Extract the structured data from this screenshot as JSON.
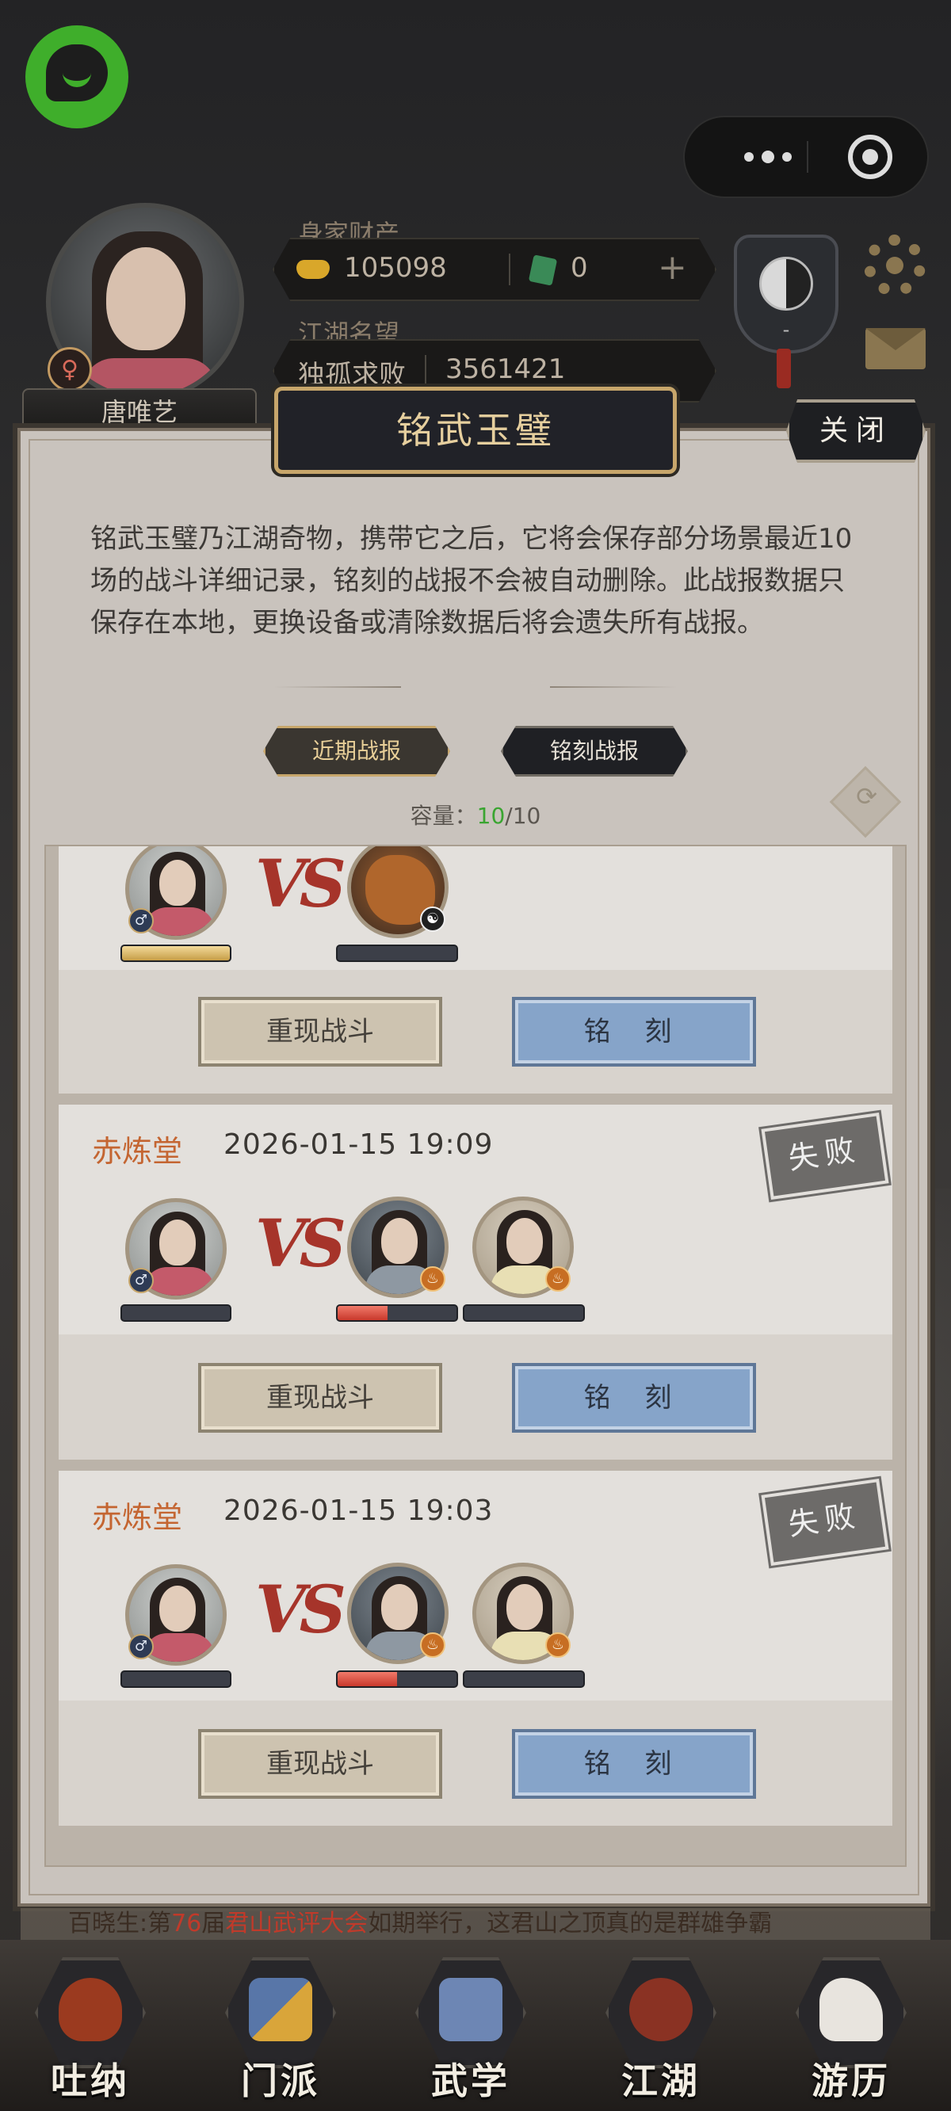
{
  "header": {
    "player_name": "唐唯艺",
    "gender_symbol": "♀",
    "wealth_label": "身家财产",
    "gold": "105098",
    "jade": "0",
    "plus": "+",
    "fame_label": "江湖名望",
    "fame_title": "独孤求败",
    "fame_value": "3561421",
    "shield_rank": "-",
    "capsule_icons": [
      "more-icon",
      "target-icon"
    ],
    "side_icons": [
      "gear-icon",
      "mail-icon"
    ]
  },
  "modal": {
    "title": "铭武玉璧",
    "close_label": "关闭",
    "description": "铭武玉璧乃江湖奇物，携带它之后，它将会保存部分场景最近10场的战斗详细记录，铭刻的战报不会被自动删除。此战报数据只保存在本地，更换设备或清除数据后将会遗失所有战报。",
    "tabs": [
      "近期战报",
      "铭刻战报"
    ],
    "capacity_label": "容量：",
    "capacity_used": "10",
    "capacity_total": "/10"
  },
  "battles": [
    {
      "faction": "",
      "time": "",
      "result": "",
      "player_hp": 1.0,
      "enemy_hp": [
        0.0
      ],
      "replay_label": "重现战斗",
      "engrave_label": "铭 刻"
    },
    {
      "faction": "赤炼堂",
      "time": "2026-01-15 19:09",
      "result": "失败",
      "player_hp": 0.0,
      "enemy_hp": [
        0.42,
        0.0
      ],
      "replay_label": "重现战斗",
      "engrave_label": "铭 刻"
    },
    {
      "faction": "赤炼堂",
      "time": "2026-01-15 19:03",
      "result": "失败",
      "player_hp": 0.0,
      "enemy_hp": [
        0.5,
        0.0
      ],
      "replay_label": "重现战斗",
      "engrave_label": "铭 刻"
    }
  ],
  "vs_label": "VS",
  "ticker": {
    "prefix": "百晓生:第",
    "number": "76",
    "mid": "届",
    "event": "君山武评大会",
    "suffix": "如期举行，这君山之顶真的是群雄争霸"
  },
  "nav": [
    {
      "label": "吐纳",
      "icon": "gourd-icon"
    },
    {
      "label": "门派",
      "icon": "flag-icon"
    },
    {
      "label": "武学",
      "icon": "scroll-icon"
    },
    {
      "label": "江湖",
      "icon": "hat-icon"
    },
    {
      "label": "游历",
      "icon": "horse-icon"
    }
  ],
  "colors": {
    "faction": "#c46531",
    "capacity_used": "#3aa531",
    "engrave_button": "#86a4c9",
    "title_gold": "#e6cf9e"
  }
}
